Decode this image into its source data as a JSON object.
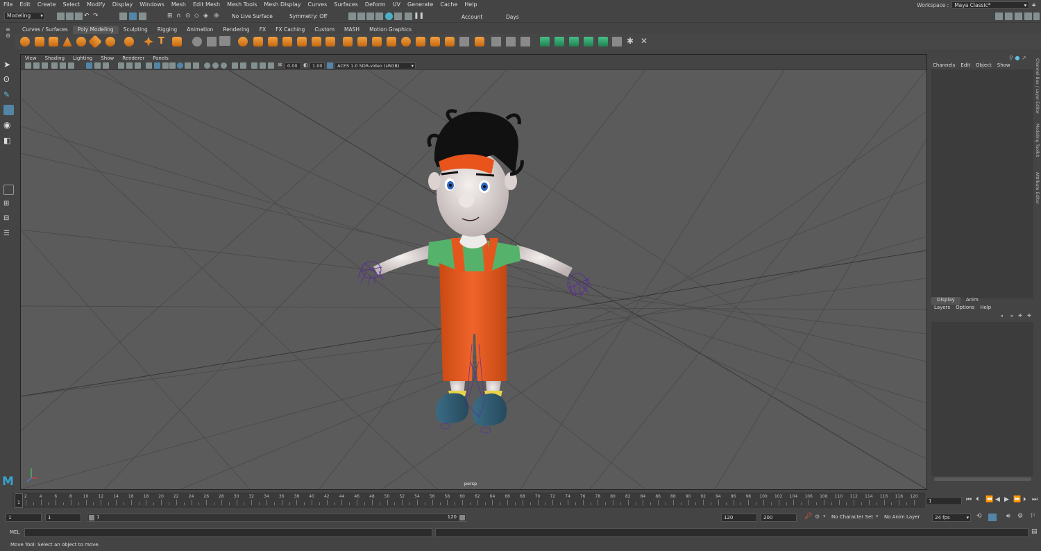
{
  "menu": [
    "File",
    "Edit",
    "Create",
    "Select",
    "Modify",
    "Display",
    "Windows",
    "Mesh",
    "Edit Mesh",
    "Mesh Tools",
    "Mesh Display",
    "Curves",
    "Surfaces",
    "Deform",
    "UV",
    "Generate",
    "Cache",
    "Help"
  ],
  "workspace": {
    "label": "Workspace :",
    "value": "Maya Classic*"
  },
  "status": {
    "mode": "Modeling",
    "live_surface": "No Live Surface",
    "symmetry": "Symmetry: Off",
    "account": "Account",
    "days": "Days"
  },
  "shelf_tabs": [
    "Curves / Surfaces",
    "Poly Modeling",
    "Sculpting",
    "Rigging",
    "Animation",
    "Rendering",
    "FX",
    "FX Caching",
    "Custom",
    "MASH",
    "Motion Graphics"
  ],
  "active_shelf_tab": "Poly Modeling",
  "viewport": {
    "menu": [
      "View",
      "Shading",
      "Lighting",
      "Show",
      "Renderer",
      "Panels"
    ],
    "exposure": "0.00",
    "gamma": "1.00",
    "color_space": "ACES 1.0 SDR-video (sRGB)",
    "camera_label": "persp"
  },
  "channel_box": {
    "menu": [
      "Channels",
      "Edit",
      "Object",
      "Show"
    ]
  },
  "layer_editor": {
    "tabs": [
      "Display",
      "Anim"
    ],
    "menu": [
      "Layers",
      "Options",
      "Help"
    ]
  },
  "side_tabs": [
    "Channel Box / Layer Editor",
    "Modeling Toolkit",
    "Attribute Editor"
  ],
  "timeline": {
    "ticks": [
      2,
      4,
      6,
      8,
      10,
      12,
      14,
      16,
      18,
      20,
      22,
      24,
      26,
      28,
      30,
      32,
      34,
      36,
      38,
      40,
      42,
      44,
      46,
      48,
      50,
      52,
      54,
      56,
      58,
      60,
      62,
      64,
      66,
      68,
      70,
      72,
      74,
      76,
      78,
      80,
      82,
      84,
      86,
      88,
      90,
      92,
      94,
      96,
      98,
      100,
      102,
      104,
      106,
      108,
      110,
      112,
      114,
      116,
      118,
      120
    ],
    "current_frame_marker": "1",
    "current_frame": "1"
  },
  "range": {
    "start": "1",
    "playback_start": "1",
    "slider_start": "1",
    "slider_end": "120",
    "playback_end": "120",
    "end": "200",
    "character_set": "No Character Set",
    "anim_layer": "No Anim Layer",
    "fps": "24 fps"
  },
  "command": {
    "lang": "MEL"
  },
  "help_line": "Move Tool: Select an object to move.",
  "colors": {
    "accent": "#5285a6",
    "shelf_orange": "#e08a2a",
    "shelf_green": "#2fa66a",
    "overall": "#f15a1f",
    "shirt": "#55b26a"
  }
}
